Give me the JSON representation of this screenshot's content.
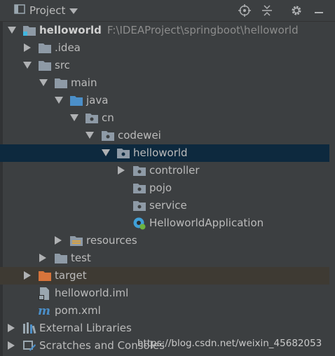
{
  "toolbar": {
    "title": "Project",
    "icons": [
      "project-window-icon",
      "chevron-down-icon",
      "locate-icon",
      "collapse-all-icon",
      "gear-icon",
      "minimize-icon"
    ]
  },
  "tree": {
    "root": {
      "name": "helloworld",
      "path": "F:\\IDEAProject\\springboot\\helloworld",
      "icon": "module-folder-icon"
    },
    "idea": {
      "name": ".idea",
      "icon": "folder-icon"
    },
    "src": {
      "name": "src",
      "icon": "folder-icon"
    },
    "main": {
      "name": "main",
      "icon": "folder-icon"
    },
    "java": {
      "name": "java",
      "icon": "source-folder-icon"
    },
    "cn": {
      "name": "cn",
      "icon": "package-icon"
    },
    "codewei": {
      "name": "codewei",
      "icon": "package-icon"
    },
    "helloworld_pkg": {
      "name": "helloworld",
      "icon": "package-icon"
    },
    "controller": {
      "name": "controller",
      "icon": "package-icon"
    },
    "pojo": {
      "name": "pojo",
      "icon": "package-icon"
    },
    "service": {
      "name": "service",
      "icon": "package-icon"
    },
    "app": {
      "name": "HelloworldApplication",
      "icon": "spring-boot-class-icon"
    },
    "resources": {
      "name": "resources",
      "icon": "resources-folder-icon"
    },
    "test": {
      "name": "test",
      "icon": "folder-icon"
    },
    "target": {
      "name": "target",
      "icon": "excluded-folder-icon"
    },
    "iml": {
      "name": "helloworld.iml",
      "icon": "iml-file-icon"
    },
    "pom": {
      "name": "pom.xml",
      "icon": "maven-icon"
    },
    "ext": {
      "name": "External Libraries",
      "icon": "libraries-icon"
    },
    "scratches": {
      "name": "Scratches and Consoles",
      "icon": "scratches-icon"
    }
  },
  "colors": {
    "background": "#3c3f41",
    "selected_row": "#0d293e",
    "excluded_row": "#3e3a33",
    "folder": "#8e9aa6",
    "source_folder": "#4b8fc9",
    "excluded_folder": "#d6743b"
  },
  "watermark": "https://blog.csdn.net/weixin_45682053"
}
